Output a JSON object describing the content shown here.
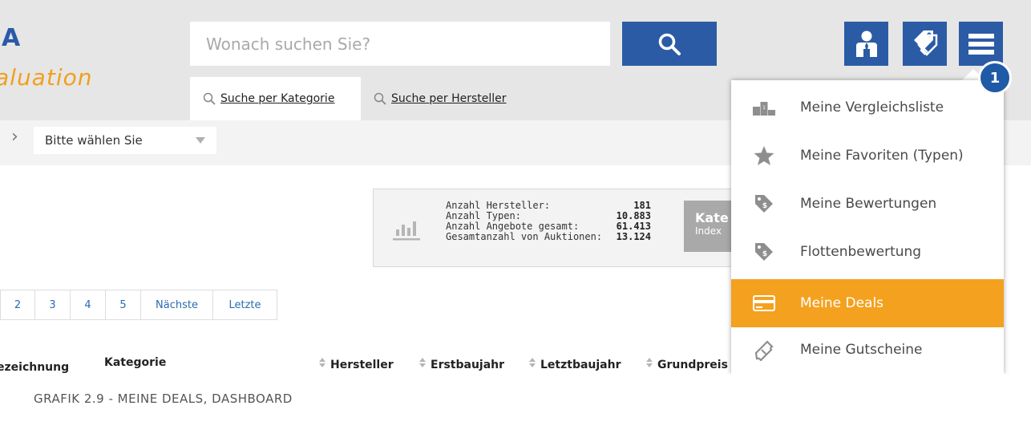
{
  "logo": {
    "letter": "A",
    "subtitle": "aluation"
  },
  "search": {
    "placeholder": "Wonach suchen Sie?"
  },
  "header_icons": [
    "search-icon",
    "user-icon",
    "price-tag-icon",
    "menu-icon"
  ],
  "badge": "1",
  "tabs": [
    {
      "label": "Suche per Kategorie",
      "active": true
    },
    {
      "label": "Suche per Hersteller",
      "active": false
    }
  ],
  "filter": {
    "select_value": "Bitte wählen Sie"
  },
  "stats": {
    "rows": [
      {
        "label": "Anzahl Hersteller:",
        "value": "181"
      },
      {
        "label": "Anzahl Typen:",
        "value": "10.883"
      },
      {
        "label": "Anzahl Angebote gesamt:",
        "value": "61.413"
      },
      {
        "label": "Gesamtanzahl von Auktionen:",
        "value": "13.124"
      }
    ],
    "kat_title": "Kate",
    "kat_sub": "Index"
  },
  "pagination": [
    "2",
    "3",
    "4",
    "5",
    "Nächste",
    "Letzte"
  ],
  "table_columns": [
    "ezeichnung",
    "Kategorie",
    "Hersteller",
    "Erstbaujahr",
    "Letztbaujahr",
    "Grundpreis"
  ],
  "menu": {
    "items": [
      {
        "label": "Meine Vergleichsliste",
        "icon": "podium-icon",
        "active": false
      },
      {
        "label": "Meine Favoriten (Typen)",
        "icon": "star-icon",
        "active": false
      },
      {
        "label": "Meine Bewertungen",
        "icon": "price-tag-icon",
        "active": false
      },
      {
        "label": "Flottenbewertung",
        "icon": "price-tag-icon",
        "active": false
      },
      {
        "label": "Meine Deals",
        "icon": "credit-card-icon",
        "active": true
      },
      {
        "label": "Meine Gutscheine",
        "icon": "ticket-icon",
        "active": false
      }
    ]
  },
  "caption": "GRAFIK 2.9 - MEINE DEALS, DASHBOARD",
  "colors": {
    "brand_blue": "#2b5ba5",
    "accent_orange": "#f4a11f",
    "logo_orange": "#f0a01c"
  }
}
